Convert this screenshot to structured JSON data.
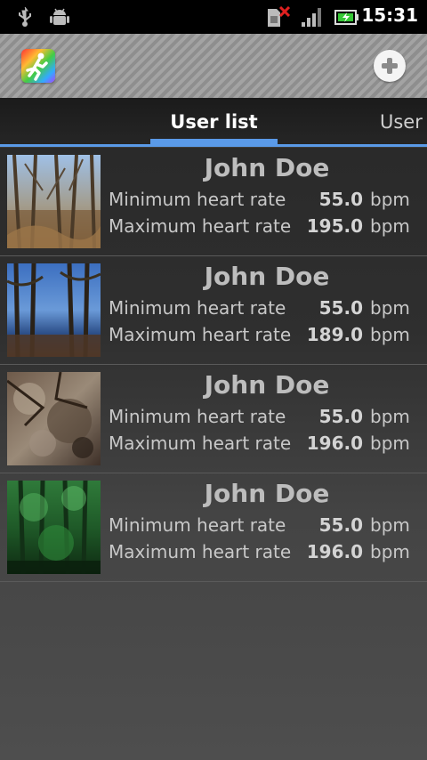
{
  "status_bar": {
    "time": "15:31",
    "icons": [
      "usb-icon",
      "android-debug-icon",
      "sim-error-icon",
      "signal-icon",
      "battery-charging-icon"
    ]
  },
  "action_bar": {
    "app_icon": "runner-app-icon",
    "action_icon": "add-icon"
  },
  "tabs": {
    "active": "User list",
    "next": "User"
  },
  "users": [
    {
      "name": "John Doe",
      "min_label": "Minimum heart rate",
      "min_value": "55.0",
      "max_label": "Maximum heart rate",
      "max_value": "195.0",
      "unit": "bpm",
      "photo": "bare-forest-photo"
    },
    {
      "name": "John Doe",
      "min_label": "Minimum heart rate",
      "min_value": "55.0",
      "max_label": "Maximum heart rate",
      "max_value": "189.0",
      "unit": "bpm",
      "photo": "lake-trees-photo"
    },
    {
      "name": "John Doe",
      "min_label": "Minimum heart rate",
      "min_value": "55.0",
      "max_label": "Maximum heart rate",
      "max_value": "196.0",
      "unit": "bpm",
      "photo": "rock-lichen-photo"
    },
    {
      "name": "John Doe",
      "min_label": "Minimum heart rate",
      "min_value": "55.0",
      "max_label": "Maximum heart rate",
      "max_value": "196.0",
      "unit": "bpm",
      "photo": "green-forest-photo"
    }
  ]
}
